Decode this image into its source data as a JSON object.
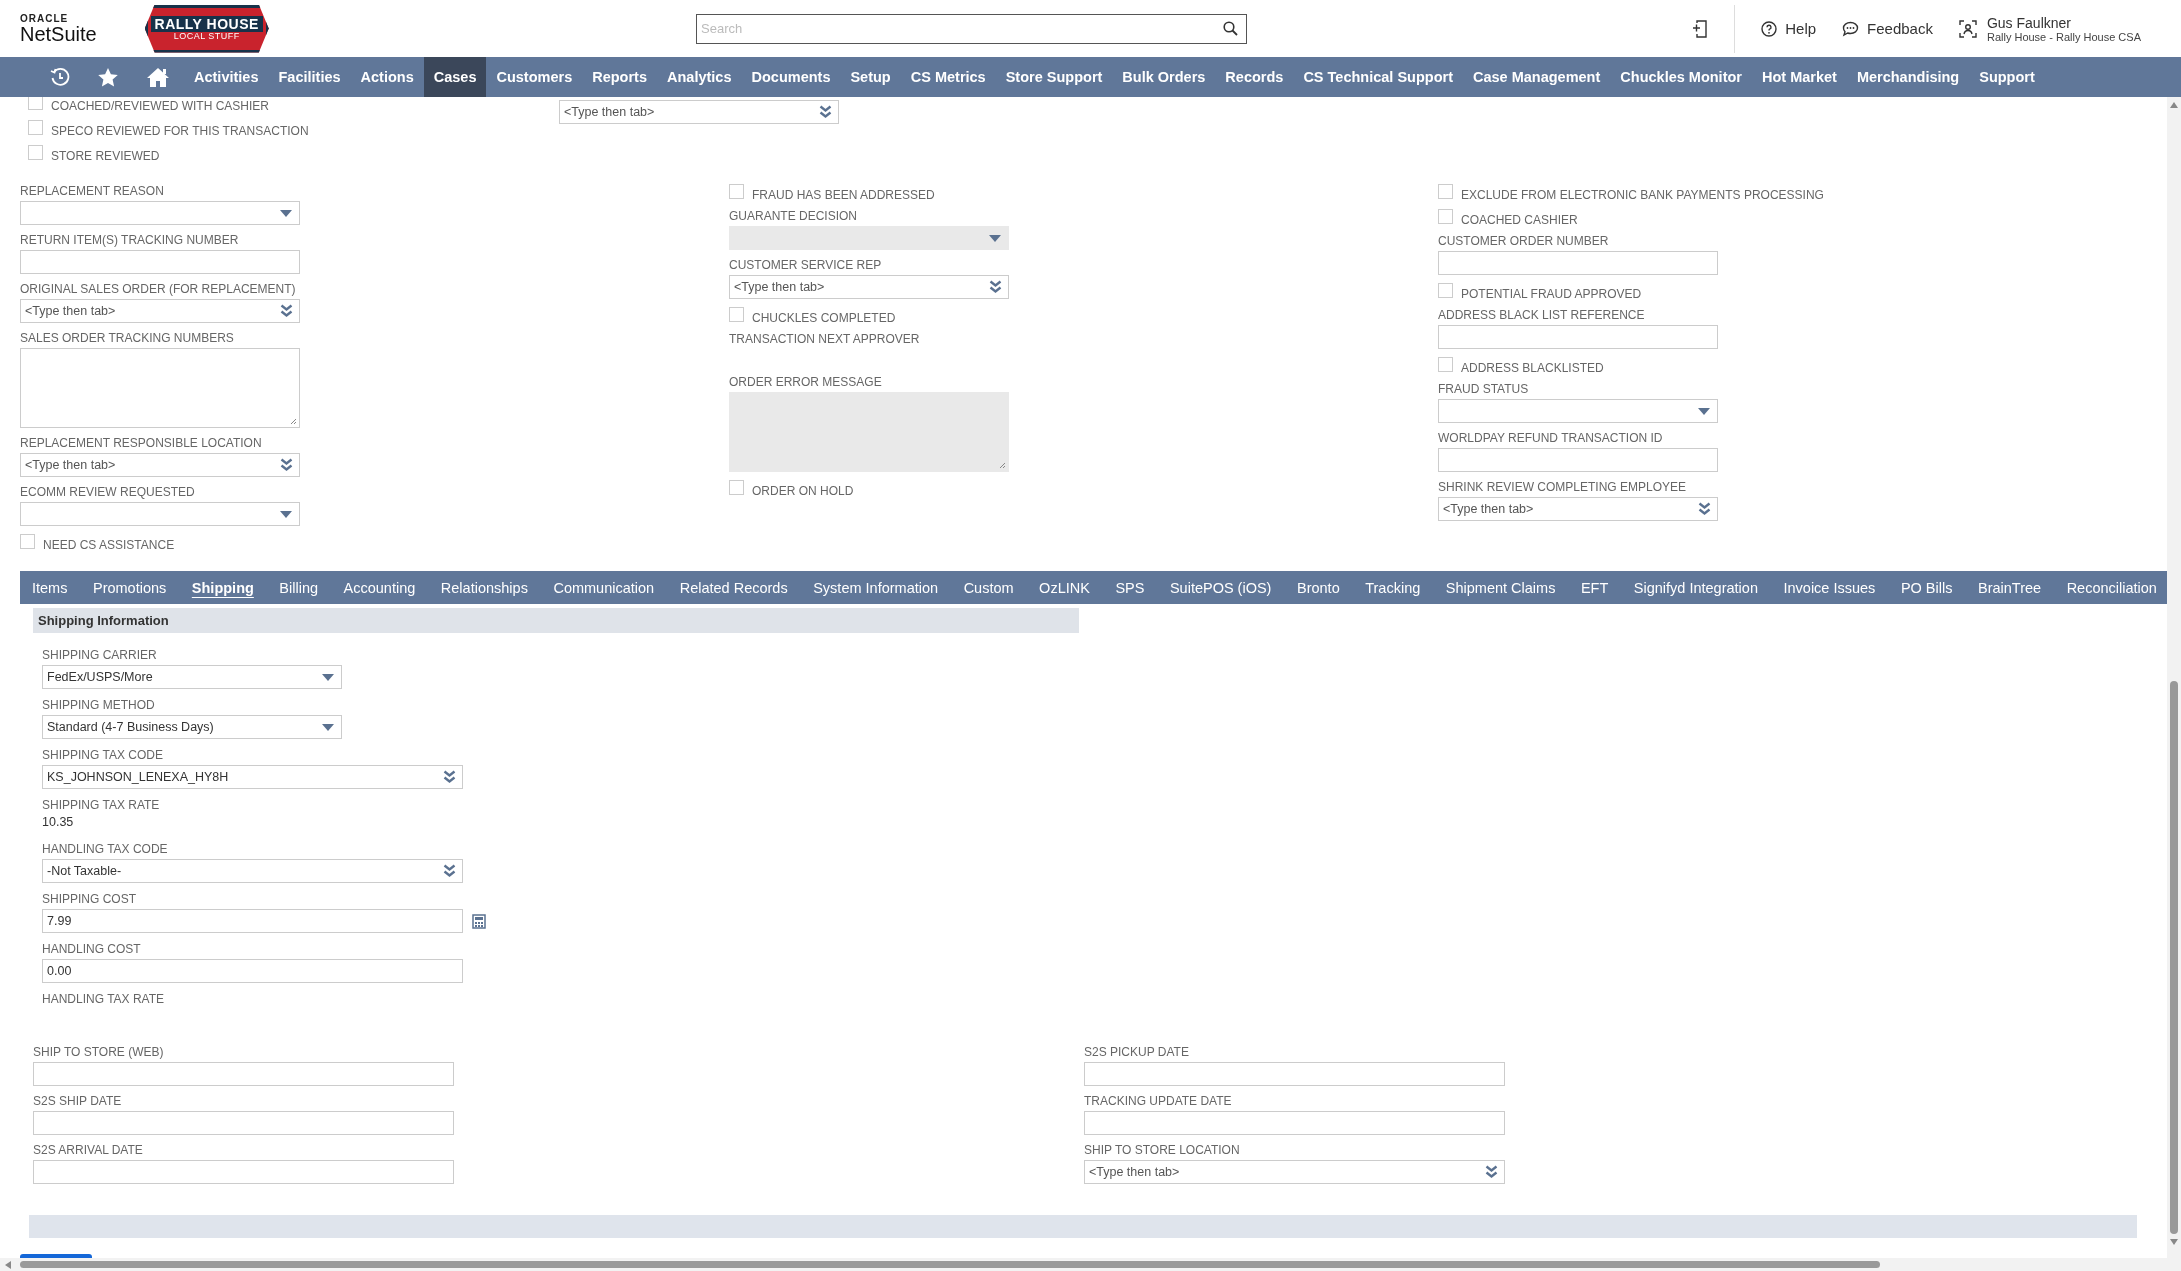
{
  "header": {
    "oracle": "ORACLE",
    "netsuite": "NetSuite",
    "logo_title": "RALLY HOUSE",
    "logo_subtitle": "LOCAL STUFF",
    "search": {
      "placeholder": "Search"
    },
    "help": "Help",
    "feedback": "Feedback",
    "user": {
      "name": "Gus Faulkner",
      "role": "Rally House - Rally House CSA"
    }
  },
  "nav": [
    {
      "label": "Activities",
      "selected": false
    },
    {
      "label": "Facilities",
      "selected": false
    },
    {
      "label": "Actions",
      "selected": false
    },
    {
      "label": "Cases",
      "selected": true
    },
    {
      "label": "Customers",
      "selected": false
    },
    {
      "label": "Reports",
      "selected": false
    },
    {
      "label": "Analytics",
      "selected": false
    },
    {
      "label": "Documents",
      "selected": false
    },
    {
      "label": "Setup",
      "selected": false
    },
    {
      "label": "CS Metrics",
      "selected": false
    },
    {
      "label": "Store Support",
      "selected": false
    },
    {
      "label": "Bulk Orders",
      "selected": false
    },
    {
      "label": "Records",
      "selected": false
    },
    {
      "label": "CS Technical Support",
      "selected": false
    },
    {
      "label": "Case Management",
      "selected": false
    },
    {
      "label": "Chuckles Monitor",
      "selected": false
    },
    {
      "label": "Hot Market",
      "selected": false
    },
    {
      "label": "Merchandising",
      "selected": false
    },
    {
      "label": "Support",
      "selected": false
    }
  ],
  "top": {
    "checkboxes": [
      {
        "kind": "checkbox",
        "label": "COACHED/REVIEWED WITH CASHIER",
        "checked": false
      },
      {
        "kind": "checkbox",
        "label": "SPECO REVIEWED FOR THIS TRANSACTION",
        "checked": false
      },
      {
        "kind": "checkbox",
        "label": "STORE REVIEWED",
        "checked": false
      }
    ],
    "field": {
      "kind": "lookup",
      "placeholder": "<Type then tab>"
    }
  },
  "columns": [
    [
      {
        "kind": "select",
        "label": "REPLACEMENT REASON"
      },
      {
        "kind": "text",
        "label": "RETURN ITEM(S) TRACKING NUMBER"
      },
      {
        "kind": "lookup",
        "label": "ORIGINAL SALES ORDER (FOR REPLACEMENT)",
        "placeholder": "<Type then tab>"
      },
      {
        "kind": "textarea",
        "label": "SALES ORDER TRACKING NUMBERS"
      },
      {
        "kind": "lookup",
        "label": "REPLACEMENT RESPONSIBLE LOCATION",
        "placeholder": "<Type then tab>"
      },
      {
        "kind": "select",
        "label": "ECOMM REVIEW REQUESTED"
      },
      {
        "kind": "checkbox",
        "label": "NEED CS ASSISTANCE",
        "checked": false
      }
    ],
    [
      {
        "kind": "checkbox",
        "label": "FRAUD HAS BEEN ADDRESSED",
        "checked": false
      },
      {
        "kind": "select",
        "label": "GUARANTE DECISION",
        "disabled": true
      },
      {
        "kind": "lookup",
        "label": "CUSTOMER SERVICE REP",
        "placeholder": "<Type then tab>"
      },
      {
        "kind": "checkbox",
        "label": "CHUCKLES COMPLETED",
        "checked": false
      },
      {
        "kind": "display",
        "label": "TRANSACTION NEXT APPROVER"
      },
      {
        "kind": "textarea",
        "label": "ORDER ERROR MESSAGE",
        "disabled": true
      },
      {
        "kind": "checkbox",
        "label": "ORDER ON HOLD",
        "checked": false
      }
    ],
    [
      {
        "kind": "checkbox",
        "label": "EXCLUDE FROM ELECTRONIC BANK PAYMENTS PROCESSING",
        "checked": false
      },
      {
        "kind": "checkbox",
        "label": "COACHED CASHIER",
        "checked": false
      },
      {
        "kind": "text",
        "label": "CUSTOMER ORDER NUMBER"
      },
      {
        "kind": "checkbox",
        "label": "POTENTIAL FRAUD APPROVED",
        "checked": false
      },
      {
        "kind": "text",
        "label": "ADDRESS BLACK LIST REFERENCE"
      },
      {
        "kind": "checkbox",
        "label": "ADDRESS BLACKLISTED",
        "checked": false
      },
      {
        "kind": "select",
        "label": "FRAUD STATUS"
      },
      {
        "kind": "text",
        "label": "WORLDPAY REFUND TRANSACTION ID"
      },
      {
        "kind": "lookup",
        "label": "SHRINK REVIEW COMPLETING EMPLOYEE",
        "placeholder": "<Type then tab>"
      }
    ]
  ],
  "tabs": [
    {
      "label": "Items",
      "selected": false
    },
    {
      "label": "Promotions",
      "selected": false
    },
    {
      "label": "Shipping",
      "selected": true
    },
    {
      "label": "Billing",
      "selected": false
    },
    {
      "label": "Accounting",
      "selected": false
    },
    {
      "label": "Relationships",
      "selected": false
    },
    {
      "label": "Communication",
      "selected": false
    },
    {
      "label": "Related Records",
      "selected": false
    },
    {
      "label": "System Information",
      "selected": false
    },
    {
      "label": "Custom",
      "selected": false
    },
    {
      "label": "OzLINK",
      "selected": false
    },
    {
      "label": "SPS",
      "selected": false
    },
    {
      "label": "SuitePOS (iOS)",
      "selected": false
    },
    {
      "label": "Bronto",
      "selected": false
    },
    {
      "label": "Tracking",
      "selected": false
    },
    {
      "label": "Shipment Claims",
      "selected": false
    },
    {
      "label": "EFT",
      "selected": false
    },
    {
      "label": "Signifyd Integration",
      "selected": false
    },
    {
      "label": "Invoice Issues",
      "selected": false
    },
    {
      "label": "PO Bills",
      "selected": false
    },
    {
      "label": "BrainTree",
      "selected": false
    },
    {
      "label": "Reconciliation",
      "selected": false
    }
  ],
  "shipping": {
    "title": "Shipping Information",
    "fields": [
      {
        "kind": "select",
        "label": "SHIPPING CARRIER",
        "value": "FedEx/USPS/More"
      },
      {
        "kind": "select",
        "label": "SHIPPING METHOD",
        "value": "Standard (4-7 Business Days)"
      },
      {
        "kind": "lookup",
        "label": "SHIPPING TAX CODE",
        "value": "KS_JOHNSON_LENEXA_HY8H",
        "wide": true
      },
      {
        "kind": "display",
        "label": "SHIPPING TAX RATE",
        "value": "10.35"
      },
      {
        "kind": "lookup",
        "label": "HANDLING TAX CODE",
        "value": "-Not Taxable-",
        "wide": true
      },
      {
        "kind": "currency",
        "label": "SHIPPING COST",
        "value": "7.99"
      },
      {
        "kind": "text",
        "label": "HANDLING COST",
        "value": "0.00",
        "wide": true
      },
      {
        "kind": "display",
        "label": "HANDLING TAX RATE"
      }
    ],
    "columns": [
      [
        {
          "kind": "text",
          "label": "SHIP TO STORE (WEB)"
        },
        {
          "kind": "text",
          "label": "S2S SHIP DATE"
        },
        {
          "kind": "text",
          "label": "S2S ARRIVAL DATE"
        }
      ],
      [
        {
          "kind": "text",
          "label": "S2S PICKUP DATE"
        },
        {
          "kind": "text",
          "label": "TRACKING UPDATE DATE"
        },
        {
          "kind": "lookup",
          "label": "SHIP TO STORE LOCATION",
          "placeholder": "<Type then tab>"
        }
      ]
    ]
  }
}
